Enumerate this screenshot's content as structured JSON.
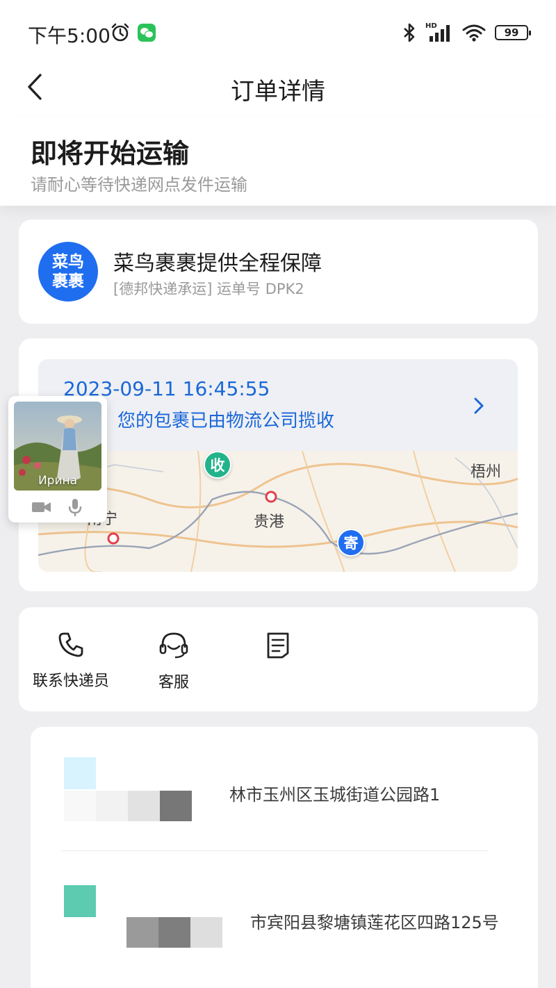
{
  "status_bar": {
    "time": "下午5:00",
    "network_tag": "HD",
    "battery": "99",
    "icons": [
      "alarm-icon",
      "wechat-icon",
      "bluetooth-icon",
      "signal-icon",
      "wifi-icon",
      "battery-icon"
    ]
  },
  "nav": {
    "title": "订单详情",
    "back_icon": "chevron-left-icon"
  },
  "order_status": {
    "title": "即将开始运输",
    "subtitle": "请耐心等待快递网点发件运输"
  },
  "insurance": {
    "logo_line1": "菜鸟",
    "logo_line2": "裹裹",
    "title": "菜鸟裹裹提供全程保障",
    "carrier_text": "[德邦快递承运] 运单号 DPK2"
  },
  "tracking": {
    "time": "2023-09-11 16:45:55",
    "description": "林市】您的包裹已由物流公司揽收",
    "map": {
      "cities": [
        "南宁",
        "贵港",
        "梧州"
      ],
      "receive_pin": "收",
      "send_pin": "寄"
    }
  },
  "video_call": {
    "caller_name": "Ирина"
  },
  "actions": [
    {
      "label": "联系快递员",
      "icon": "phone-icon"
    },
    {
      "label": "客服",
      "icon": "headset-icon"
    },
    {
      "label": "",
      "icon": "document-icon"
    }
  ],
  "addresses": [
    {
      "address": "林市玉州区玉城街道公园路1"
    },
    {
      "address": "市宾阳县黎塘镇莲花区四路125号"
    }
  ],
  "colors": {
    "accent_blue": "#1f6ef0",
    "link_blue": "#1a67d8",
    "receive_green": "#22b38a",
    "background": "#eeeef1"
  }
}
